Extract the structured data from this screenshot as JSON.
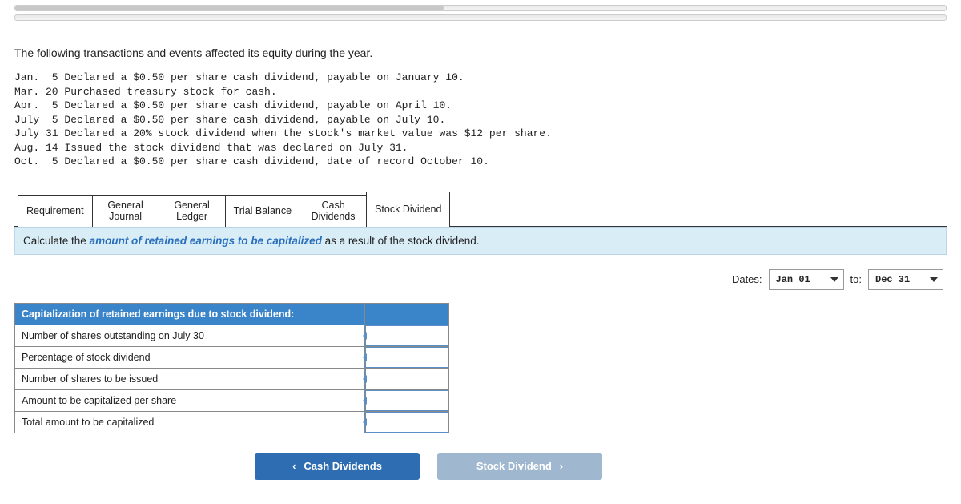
{
  "intro": "The following transactions and events affected its equity during the year.",
  "transactions": [
    "Jan.  5 Declared a $0.50 per share cash dividend, payable on January 10.",
    "Mar. 20 Purchased treasury stock for cash.",
    "Apr.  5 Declared a $0.50 per share cash dividend, payable on April 10.",
    "July  5 Declared a $0.50 per share cash dividend, payable on July 10.",
    "July 31 Declared a 20% stock dividend when the stock's market value was $12 per share.",
    "Aug. 14 Issued the stock dividend that was declared on July 31.",
    "Oct.  5 Declared a $0.50 per share cash dividend, date of record October 10."
  ],
  "tabs": {
    "items": [
      {
        "label": "Requirement"
      },
      {
        "label": "General\nJournal"
      },
      {
        "label": "General\nLedger"
      },
      {
        "label": "Trial Balance"
      },
      {
        "label": "Cash\nDividends"
      },
      {
        "label": "Stock Dividend"
      }
    ],
    "active_index": 5
  },
  "instruction": {
    "prefix": "Calculate the ",
    "highlight": "amount of retained earnings to be capitalized",
    "suffix": " as a result of the stock dividend."
  },
  "dates": {
    "label": "Dates:",
    "from": "Jan 01",
    "to_label": "to:",
    "to": "Dec 31"
  },
  "calc_table": {
    "header": "Capitalization of retained earnings due to stock dividend:",
    "rows": [
      "Number of shares outstanding on July 30",
      "Percentage of stock dividend",
      "Number of shares to be issued",
      "Amount to be capitalized per share",
      "Total amount to be capitalized"
    ]
  },
  "nav": {
    "prev": "Cash Dividends",
    "next": "Stock Dividend"
  }
}
